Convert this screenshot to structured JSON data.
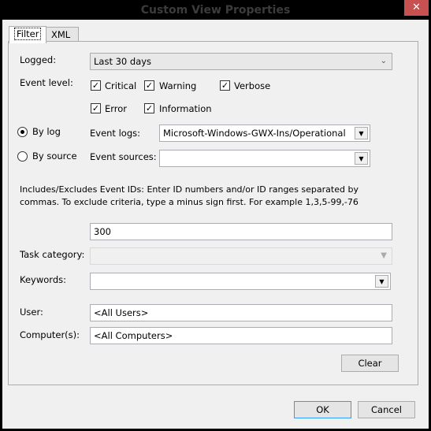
{
  "window": {
    "title": "Custom View Properties",
    "close_icon": "close-icon"
  },
  "tabs": [
    {
      "label": "Filter",
      "active": true
    },
    {
      "label": "XML",
      "active": false
    }
  ],
  "filter": {
    "logged": {
      "label": "Logged:",
      "value": "Last 30 days"
    },
    "event_level": {
      "label": "Event level:",
      "options": [
        {
          "label": "Critical",
          "checked": true
        },
        {
          "label": "Warning",
          "checked": true
        },
        {
          "label": "Verbose",
          "checked": true
        },
        {
          "label": "Error",
          "checked": true
        },
        {
          "label": "Information",
          "checked": true
        }
      ]
    },
    "by_log": {
      "label": "By log",
      "selected": true
    },
    "by_source": {
      "label": "By source",
      "selected": false
    },
    "event_logs": {
      "label": "Event logs:",
      "value": "Microsoft-Windows-GWX-Ins/Operational"
    },
    "event_sources": {
      "label": "Event sources:",
      "value": ""
    },
    "event_ids_help": "Includes/Excludes Event IDs: Enter ID numbers and/or ID ranges separated by commas. To exclude criteria, type a minus sign first. For example 1,3,5-99,-76",
    "event_ids_value": "300",
    "task_category": {
      "label": "Task category:",
      "value": ""
    },
    "keywords": {
      "label": "Keywords:",
      "value": ""
    },
    "user": {
      "label": "User:",
      "value": "<All Users>"
    },
    "computers": {
      "label": "Computer(s):",
      "value": "<All Computers>"
    },
    "clear_label": "Clear"
  },
  "footer": {
    "ok_label": "OK",
    "cancel_label": "Cancel"
  }
}
